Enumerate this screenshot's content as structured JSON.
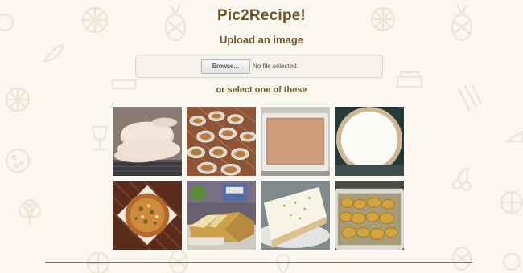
{
  "app": {
    "title": "Pic2Recipe!"
  },
  "upload": {
    "heading": "Upload an image",
    "browse_label": "Browse...",
    "file_status": "No file selected."
  },
  "gallery": {
    "heading": "or select one of these",
    "images": [
      {
        "subject": "sugar cookies"
      },
      {
        "subject": "cupcakes in paper liners"
      },
      {
        "subject": "baked dish in a pan"
      },
      {
        "subject": "pie crust with white filling"
      },
      {
        "subject": "topped flatbread pizza"
      },
      {
        "subject": "sliced loaf cake"
      },
      {
        "subject": "slice of frosted cake"
      },
      {
        "subject": "roasted potatoes in a dish"
      }
    ]
  },
  "colors": {
    "background": "#faf8ee",
    "heading": "#6d5325",
    "panel": "#f4f2ea",
    "doodle": "#ece8da"
  },
  "icons": {
    "background": [
      "lemon-slice-icon",
      "pineapple-icon",
      "fish-icon",
      "wine-glass-icon",
      "cookie-icon",
      "asparagus-icon",
      "cheese-icon",
      "cherries-icon",
      "broccoli-icon",
      "cake-icon",
      "pepper-icon"
    ]
  }
}
